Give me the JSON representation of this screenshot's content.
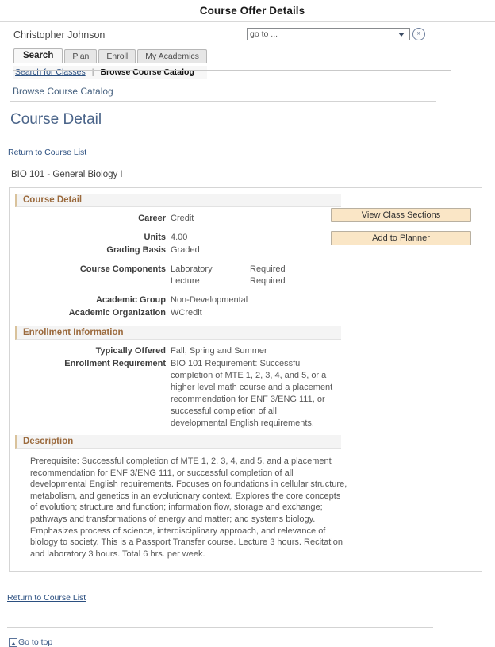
{
  "window": {
    "title": "Course Offer Details"
  },
  "header": {
    "user_name": "Christopher Johnson",
    "goto": {
      "selected": "go to ...",
      "submit_label": "»"
    }
  },
  "tabs": [
    {
      "label": "Search",
      "active": true
    },
    {
      "label": "Plan",
      "active": false
    },
    {
      "label": "Enroll",
      "active": false
    },
    {
      "label": "My Academics",
      "active": false
    }
  ],
  "sublinks": {
    "first": "Search for Classes",
    "separator": "|",
    "current": "Browse Course Catalog"
  },
  "breadcrumb": "Browse Course Catalog",
  "page_heading": "Course Detail",
  "return_link_top": "Return to Course List",
  "course_line": "BIO  101 - General Biology I",
  "sections": {
    "course_detail": {
      "header": "Course Detail",
      "fields": [
        {
          "label": "Career",
          "value": "Credit"
        },
        {
          "label": "Units",
          "value": "4.00"
        },
        {
          "label": "Grading Basis",
          "value": "Graded"
        }
      ],
      "components_label": "Course Components",
      "components": [
        {
          "name": "Laboratory",
          "requirement": "Required"
        },
        {
          "name": "Lecture",
          "requirement": "Required"
        }
      ],
      "fields2": [
        {
          "label": "Academic Group",
          "value": "Non-Developmental"
        },
        {
          "label": "Academic Organization",
          "value": "WCredit"
        }
      ]
    },
    "enrollment_information": {
      "header": "Enrollment Information",
      "typically_offered_label": "Typically Offered",
      "typically_offered_value": "Fall, Spring and Summer",
      "enrollment_requirement_label": "Enrollment Requirement",
      "enrollment_requirement_value": "BIO 101 Requirement: Successful completion of MTE 1, 2, 3, 4, and 5, or a higher level math course and a placement recommendation for ENF 3/ENG 111, or successful completion of all developmental English requirements."
    },
    "description": {
      "header": "Description",
      "body": "Prerequisite: Successful completion of MTE 1, 2, 3, 4, and 5, and a placement recommendation for ENF 3/ENG 111, or successful completion of all developmental English requirements. Focuses on foundations in cellular structure, metabolism, and genetics in an evolutionary context. Explores the core concepts of evolution; structure and function; information flow, storage and exchange; pathways and transformations of energy and matter; and systems biology. Emphasizes process of science, interdisciplinary approach, and relevance of biology to society.  This is a Passport Transfer course. Lecture 3 hours. Recitation and laboratory 3 hours. Total 6 hrs. per week."
    }
  },
  "buttons": {
    "view_class_sections": "View Class Sections",
    "add_to_planner": "Add to Planner"
  },
  "footer": {
    "return_link": "Return to Course List",
    "go_to_top": "Go to top"
  },
  "colors": {
    "section_header_text": "#9b6a3d",
    "button_background": "#fae6c6",
    "link": "#2b4f80",
    "heading": "#4a6489"
  }
}
